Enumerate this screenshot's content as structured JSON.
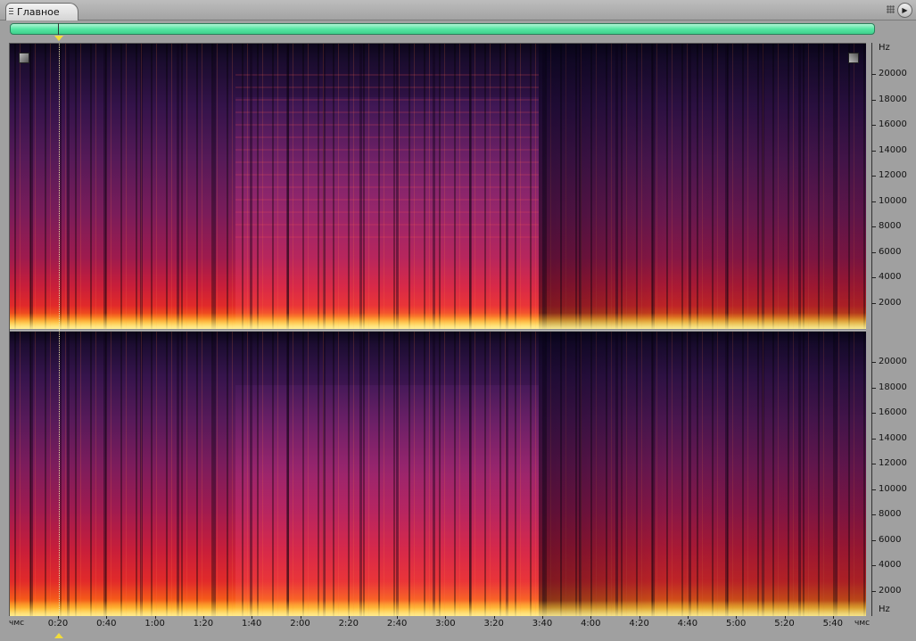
{
  "tab": {
    "label": "Главное"
  },
  "spectral": {
    "channels": [
      "top",
      "bottom"
    ],
    "palette": {
      "low": "#0c061a",
      "mid": "#c81e3a",
      "high": "#ffe27a"
    }
  },
  "hz_ruler": {
    "unit": "Hz",
    "labels": [
      "20000",
      "18000",
      "16000",
      "14000",
      "12000",
      "10000",
      "8000",
      "6000",
      "4000",
      "2000"
    ]
  },
  "time_ruler": {
    "unit_left": "чмс",
    "unit_right": "чмс",
    "labels": [
      "0:20",
      "0:40",
      "1:00",
      "1:20",
      "1:40",
      "2:00",
      "2:20",
      "2:40",
      "3:00",
      "3:20",
      "3:40",
      "4:00",
      "4:20",
      "4:40",
      "5:00",
      "5:20",
      "5:40"
    ]
  },
  "playhead": {
    "time": "0:20"
  }
}
